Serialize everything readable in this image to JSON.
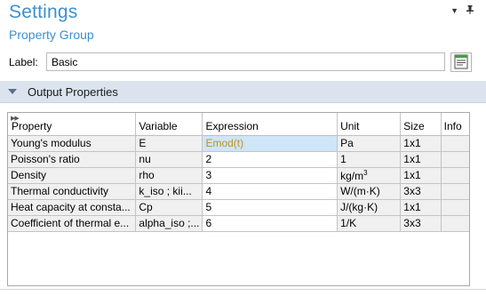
{
  "header": {
    "title": "Settings",
    "subtitle": "Property Group",
    "dropdown_icon": "chevron-down-icon",
    "pin_icon": "pin-icon"
  },
  "label_field": {
    "label": "Label:",
    "value": "Basic"
  },
  "section": {
    "title": "Output Properties"
  },
  "table": {
    "columns": [
      "Property",
      "Variable",
      "Expression",
      "Unit",
      "Size",
      "Info"
    ],
    "rows": [
      {
        "property": "Young's modulus",
        "variable": "E",
        "expression": "Emod(t)",
        "unit": "Pa",
        "size": "1x1",
        "info": ""
      },
      {
        "property": "Poisson's ratio",
        "variable": "nu",
        "expression": "2",
        "unit": "1",
        "size": "1x1",
        "info": ""
      },
      {
        "property": "Density",
        "variable": "rho",
        "expression": "3",
        "unit_base": "kg/m",
        "unit_sup": "3",
        "size": "1x1",
        "info": ""
      },
      {
        "property": "Thermal conductivity",
        "variable": "k_iso ; kii...",
        "expression": "4",
        "unit": "W/(m·K)",
        "size": "3x3",
        "info": ""
      },
      {
        "property": "Heat capacity at consta...",
        "variable": "Cp",
        "expression": "5",
        "unit": "J/(kg·K)",
        "size": "1x1",
        "info": ""
      },
      {
        "property": "Coefficient of thermal e...",
        "variable": "alpha_iso ;...",
        "expression": "6",
        "unit": "1/K",
        "size": "3x3",
        "info": ""
      }
    ]
  },
  "colors": {
    "title_blue": "#3c8fd0",
    "section_bg": "#dbe4ee",
    "active_cell_bg": "#cfe5f8",
    "function_text": "#bf9321"
  }
}
